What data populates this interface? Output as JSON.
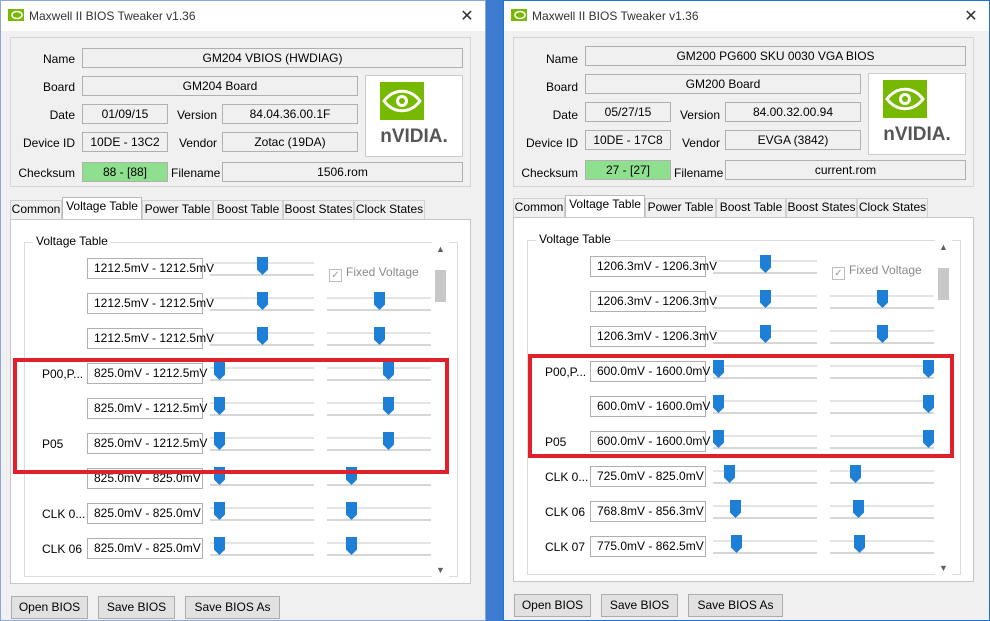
{
  "windows": [
    {
      "title": "Maxwell II BIOS Tweaker v1.36",
      "name_label": "Name",
      "name": "GM204 VBIOS (HWDIAG)",
      "board_label": "Board",
      "board": "GM204 Board",
      "date_label": "Date",
      "date": "01/09/15",
      "version_label": "Version",
      "version": "84.04.36.00.1F",
      "device_label": "Device ID",
      "device_id": "10DE - 13C2",
      "vendor_label": "Vendor",
      "vendor": "Zotac (19DA)",
      "checksum_label": "Checksum",
      "checksum": "88 - [88]",
      "filename_label": "Filename",
      "filename": "1506.rom",
      "logo_text": "nVIDIA.",
      "tabs": [
        "Common",
        "Voltage Table",
        "Power Table",
        "Boost Table",
        "Boost States",
        "Clock States"
      ],
      "group_title": "Voltage Table",
      "fixed_voltage": "Fixed Voltage",
      "rows": [
        {
          "label": "",
          "range": "1212.5mV - 1212.5mV",
          "s1": 0.5,
          "s2": null
        },
        {
          "label": "",
          "range": "1212.5mV - 1212.5mV",
          "s1": 0.5,
          "s2": 0.5
        },
        {
          "label": "",
          "range": "1212.5mV - 1212.5mV",
          "s1": 0.5,
          "s2": 0.5
        },
        {
          "label": "P00,P...",
          "range": "825.0mV - 1212.5mV",
          "s1": 0.04,
          "s2": 0.6
        },
        {
          "label": "",
          "range": "825.0mV - 1212.5mV",
          "s1": 0.04,
          "s2": 0.6
        },
        {
          "label": "P05",
          "range": "825.0mV - 1212.5mV",
          "s1": 0.04,
          "s2": 0.6
        },
        {
          "label": "",
          "range": "825.0mV - 825.0mV",
          "s1": 0.04,
          "s2": 0.2
        },
        {
          "label": "CLK 0...",
          "range": "825.0mV - 825.0mV",
          "s1": 0.04,
          "s2": 0.2
        },
        {
          "label": "CLK 06",
          "range": "825.0mV - 825.0mV",
          "s1": 0.04,
          "s2": 0.2
        }
      ],
      "buttons": {
        "open": "Open BIOS",
        "save": "Save BIOS",
        "save_as": "Save BIOS As"
      }
    },
    {
      "title": "Maxwell II BIOS Tweaker v1.36",
      "name_label": "Name",
      "name": "GM200 PG600 SKU 0030 VGA BIOS",
      "board_label": "Board",
      "board": "GM200 Board",
      "date_label": "Date",
      "date": "05/27/15",
      "version_label": "Version",
      "version": "84.00.32.00.94",
      "device_label": "Device ID",
      "device_id": "10DE - 17C8",
      "vendor_label": "Vendor",
      "vendor": "EVGA (3842)",
      "checksum_label": "Checksum",
      "checksum": "27 - [27]",
      "filename_label": "Filename",
      "filename": "current.rom",
      "logo_text": "nVIDIA.",
      "tabs": [
        "Common",
        "Voltage Table",
        "Power Table",
        "Boost Table",
        "Boost States",
        "Clock States"
      ],
      "group_title": "Voltage Table",
      "fixed_voltage": "Fixed Voltage",
      "rows": [
        {
          "label": "",
          "range": "1206.3mV - 1206.3mV",
          "s1": 0.5,
          "s2": null
        },
        {
          "label": "",
          "range": "1206.3mV - 1206.3mV",
          "s1": 0.5,
          "s2": 0.5
        },
        {
          "label": "",
          "range": "1206.3mV - 1206.3mV",
          "s1": 0.5,
          "s2": 0.5
        },
        {
          "label": "P00,P...",
          "range": "600.0mV - 1600.0mV",
          "s1": 0.0,
          "s2": 1.0
        },
        {
          "label": "",
          "range": "600.0mV - 1600.0mV",
          "s1": 0.0,
          "s2": 1.0
        },
        {
          "label": "P05",
          "range": "600.0mV - 1600.0mV",
          "s1": 0.0,
          "s2": 1.0
        },
        {
          "label": "CLK 0...",
          "range": "725.0mV - 825.0mV",
          "s1": 0.12,
          "s2": 0.22
        },
        {
          "label": "CLK 06",
          "range": "768.8mV - 856.3mV",
          "s1": 0.18,
          "s2": 0.25
        },
        {
          "label": "CLK 07",
          "range": "775.0mV - 862.5mV",
          "s1": 0.19,
          "s2": 0.26
        }
      ],
      "buttons": {
        "open": "Open BIOS",
        "save": "Save BIOS",
        "save_as": "Save BIOS As"
      }
    }
  ],
  "colors": {
    "highlight": "#e0202a",
    "checksum_ok": "#8ee08e",
    "slider_thumb": "#1e7fd6",
    "nvidia_green": "#76b900"
  }
}
